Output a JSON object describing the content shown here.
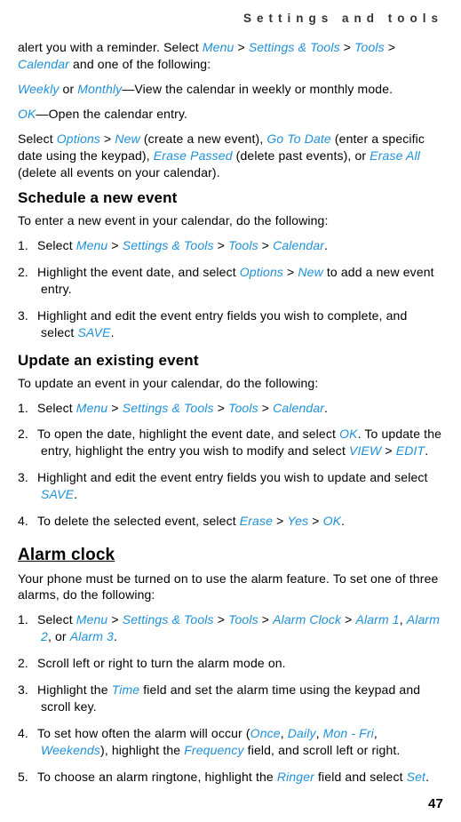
{
  "running_head": "Settings and tools",
  "intro": {
    "p1_a": "alert you with a reminder. Select ",
    "menu": "Menu",
    "sep": " > ",
    "settings_tools": "Settings & Tools",
    "tools": "Tools",
    "calendar": "Calendar",
    "p1_b": " and one of the following:",
    "weekly": "Weekly",
    "or": " or ",
    "monthly": "Monthly",
    "p2_tail": "—View the calendar in weekly or monthly mode.",
    "ok": "OK",
    "p3_tail": "—Open the calendar entry.",
    "p4_a": "Select ",
    "options": "Options",
    "new": "New",
    "p4_b": " (create a new event), ",
    "goto": "Go To Date",
    "p4_c": " (enter a specific date using the keypad), ",
    "erase_passed": "Erase Passed",
    "p4_d": " (delete past events), or ",
    "erase_all": "Erase All",
    "p4_e": " (delete all events on your calendar)."
  },
  "schedule": {
    "heading": "Schedule a new event",
    "lead": "To enter a new event in your calendar, do the following:",
    "n1": "1.",
    "s1_a": "Select ",
    "menu": "Menu",
    "sep": " > ",
    "settings_tools": "Settings & Tools",
    "tools": "Tools",
    "calendar": "Calendar",
    "dot": ".",
    "n2": "2.",
    "s2_a": "Highlight the event date, and select ",
    "options": "Options",
    "new": "New",
    "s2_b": " to add a new event entry.",
    "n3": "3.",
    "s3_a": "Highlight and edit the event entry fields you wish to complete, and select ",
    "save": "SAVE"
  },
  "update": {
    "heading": "Update an existing event",
    "lead": "To update an event in your calendar, do the following:",
    "n1": "1.",
    "s1_a": "Select ",
    "menu": "Menu",
    "sep": " > ",
    "settings_tools": "Settings & Tools",
    "tools": "Tools",
    "calendar": "Calendar",
    "dot": ".",
    "n2": "2.",
    "s2_a": "To open the date, highlight the event date, and select ",
    "ok": "OK",
    "s2_b": ". To update the entry, highlight the entry you wish to modify and select ",
    "view": "VIEW",
    "edit": "EDIT",
    "n3": "3.",
    "s3_a": "Highlight and edit the event entry fields you wish to update and select ",
    "save": "SAVE",
    "n4": "4.",
    "s4_a": "To delete the selected event, select ",
    "erase": "Erase",
    "yes": "Yes",
    "ok2": "OK"
  },
  "alarm": {
    "heading": "Alarm clock",
    "lead": "Your phone must be turned on to use the alarm feature. To set one of three alarms, do the following:",
    "n1": "1.",
    "s1_a": "Select ",
    "menu": "Menu",
    "sep": " > ",
    "settings_tools": "Settings & Tools",
    "tools": "Tools",
    "alarm_clock": "Alarm Clock",
    "alarm1": "Alarm 1",
    "comma": ", ",
    "alarm2": "Alarm 2",
    "comma_or": ", or ",
    "alarm3": "Alarm 3",
    "dot": ".",
    "n2": "2.",
    "s2": "Scroll left or right to turn the alarm mode on.",
    "n3": "3.",
    "s3_a": "Highlight the ",
    "time": "Time",
    "s3_b": " field and set the alarm time using the keypad and scroll key.",
    "n4": "4.",
    "s4_a": "To set how often the alarm will occur (",
    "once": "Once",
    "daily": "Daily",
    "monfri": "Mon - Fri",
    "weekends": "Weekends",
    "s4_b": "), highlight the ",
    "frequency": "Frequency",
    "s4_c": " field, and scroll left or right.",
    "n5": "5.",
    "s5_a": "To choose an alarm ringtone, highlight the ",
    "ringer": "Ringer",
    "s5_b": " field and select ",
    "set": "Set"
  },
  "page_number": "47"
}
